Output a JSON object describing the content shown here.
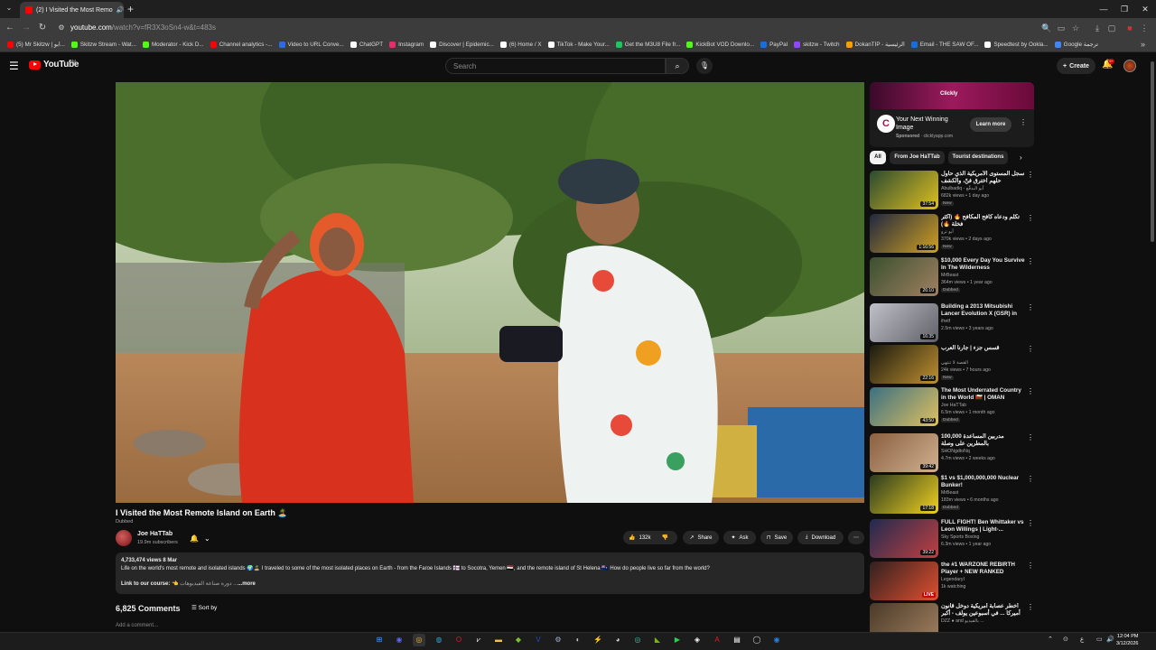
{
  "browser": {
    "tab_title": "(2) I Visited the Most Remo",
    "url_host": "youtube.com",
    "url_path": "/watch?v=fR3X3oSn4-w&t=483s",
    "bookmarks": [
      {
        "label": "(5) Mr Skitzw | ابو...",
        "color": "#ff0000"
      },
      {
        "label": "Skitzw Stream - Wat...",
        "color": "#53fc18"
      },
      {
        "label": "Moderator - Kick D...",
        "color": "#53fc18"
      },
      {
        "label": "Channel analytics -...",
        "color": "#ff0000"
      },
      {
        "label": "Video to URL Conve...",
        "color": "#2a6de0"
      },
      {
        "label": "ChatGPT",
        "color": "#ffffff"
      },
      {
        "label": "Instagram",
        "color": "#e1306c"
      },
      {
        "label": "Discover | Epidemic...",
        "color": "#ffffff"
      },
      {
        "label": "(6) Home / X",
        "color": "#ffffff"
      },
      {
        "label": "TikTok - Make Your...",
        "color": "#ffffff"
      },
      {
        "label": "Get the M3U8 File fr...",
        "color": "#21c45d"
      },
      {
        "label": "KickBot VOD Downlo...",
        "color": "#53fc18"
      },
      {
        "label": "PayPal",
        "color": "#1a6ed8"
      },
      {
        "label": "skitzw - Twitch",
        "color": "#9146ff"
      },
      {
        "label": "DokanTIP - الرئيسية",
        "color": "#f6a000"
      },
      {
        "label": "Email - THE SAW OF...",
        "color": "#1a6ed8"
      },
      {
        "label": "Speedtest by Ookla...",
        "color": "#ffffff"
      },
      {
        "label": "Google ترجمة",
        "color": "#4285f4"
      }
    ]
  },
  "youtube": {
    "logo_text": "YouTube",
    "logo_region": "OM",
    "search_placeholder": "Search",
    "create_label": "Create",
    "notification_count": "9+"
  },
  "video": {
    "title": "I Visited the Most Remote Island on Earth 🏝️",
    "dubbed": "Dubbed",
    "channel": "Joe HaTTab",
    "subscribers": "19.9m subscribers",
    "likes": "132k",
    "share": "Share",
    "ask": "Ask",
    "save": "Save",
    "download": "Download",
    "views_date": "4,733,474 views  8 Mar",
    "description": "Life on the world's most remote and isolated islands 🌍🏝️ I traveled to some of the most isolated places on Earth - from the Faroe Islands 🇫🇴 to Socotra, Yemen 🇾🇪, and the remote island of St Helena 🇸🇭 How do people live so far from the world?",
    "course_label": "Link to our course:",
    "course_text": "👈 دورة صناعة الفيديوهات ...",
    "more": "...more",
    "comments_count": "6,825 Comments",
    "sort_by": "Sort by",
    "add_comment": "Add a comment..."
  },
  "ad": {
    "brand": "Clickly",
    "title": "Your Next Winning Image",
    "sponsored": "Sponsored",
    "domain": "clicklyapp.com",
    "cta": "Learn more"
  },
  "chips": [
    "All",
    "From Joe HaTTab",
    "Tourist destinations"
  ],
  "recommendations": [
    {
      "title": "سجل المستوى الأمريكية الذي حاول حلهم اخترق فنّ، والكشف",
      "channel": "Abulbadiq - أبو البدقّع",
      "meta": "682k views • 1 day ago",
      "badge": "New",
      "duration": "37:54",
      "color1": "#2a4a30",
      "color2": "#e0c020"
    },
    {
      "title": "تكلم ودعاه كافح المكافح 🔥 (أكثر فخلة 🔥)",
      "channel": "أبو ترو",
      "meta": "370k views • 2 days ago",
      "badge": "New",
      "duration": "1:16:56",
      "color1": "#202840",
      "color2": "#d0a020"
    },
    {
      "title": "$10,000 Every Day You Survive In The Wilderness",
      "channel": "MrBeast",
      "meta": "364m views • 1 year ago",
      "badge": "Dubbed",
      "duration": "26:10",
      "color1": "#3a5030",
      "color2": "#a08060"
    },
    {
      "title": "Building a 2013 Mitsubishi Lancer Evolution X (GSR) in 16...",
      "channel": "ifretf",
      "meta": "2.5m views • 3 years ago",
      "badge": "",
      "duration": "16:35",
      "color1": "#c0c0c8",
      "color2": "#606068"
    },
    {
      "title": "قسس جزء | جارنا العرب",
      "channel": "القصة لا تنتهي",
      "meta": "24k views • 7 hours ago",
      "badge": "New",
      "duration": "22:16",
      "color1": "#1a1a10",
      "color2": "#c09030"
    },
    {
      "title": "The Most Underrated Country in the World 🇴🇲 | OMAN",
      "channel": "Joe HaTTab",
      "meta": "6.5m views • 1 month ago",
      "badge": "Dubbed",
      "duration": "43:50",
      "color1": "#3a7080",
      "color2": "#e0c060"
    },
    {
      "title": "100,000 مدربين المساعدة بالمطرين على وصلة",
      "channel": "SHONgdtoNq",
      "meta": "4.7m views • 2 weeks ago",
      "badge": "",
      "duration": "39:42",
      "color1": "#8a6040",
      "color2": "#d0b090"
    },
    {
      "title": "$1 vs $1,000,000,000 Nuclear Bunker!",
      "channel": "MrBeast",
      "meta": "183m views • 6 months ago",
      "badge": "Dubbed",
      "duration": "17:18",
      "color1": "#2a3a20",
      "color2": "#f0d020"
    },
    {
      "title": "FULL FIGHT! Ben Whittaker vs Leon Willings | Light-...",
      "channel": "Sky Sports Boxing",
      "meta": "6.3m views • 1 year ago",
      "badge": "",
      "duration": "39:22",
      "color1": "#202a50",
      "color2": "#c04040"
    },
    {
      "title": "the #1 WARZONE REBIRTH Player + NEW RANKED UPDATE",
      "channel": "LegendaryI",
      "meta": "1k watching",
      "badge": "",
      "duration": "LIVE",
      "color1": "#302020",
      "color2": "#e05030"
    },
    {
      "title": "أخطر عصابة أمريكية دوخل قانون أميركا ... في أسبوعين يولف - أكبر عملية تهريب",
      "channel": "DZZ ● and بالفيديو ...",
      "meta": "",
      "badge": "",
      "duration": "",
      "color1": "#4a3a28",
      "color2": "#a08060"
    }
  ],
  "taskbar": {
    "time": "12:04 PM",
    "date": "3/12/2026"
  }
}
